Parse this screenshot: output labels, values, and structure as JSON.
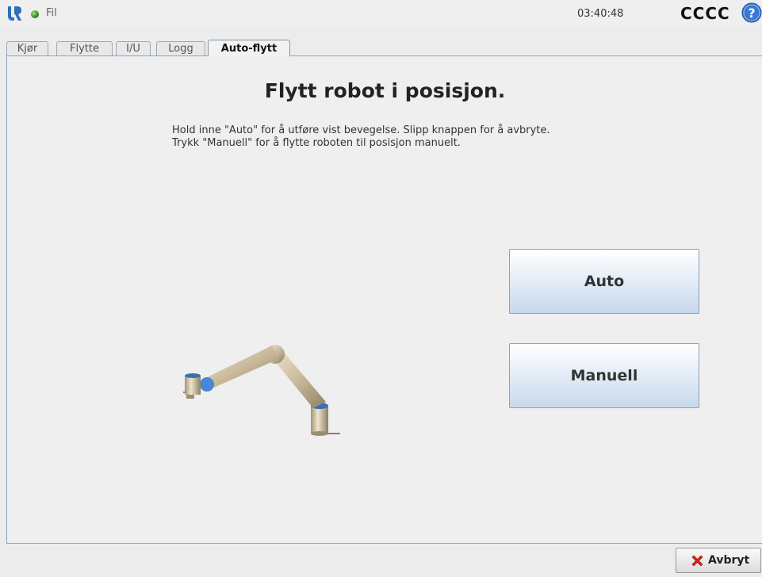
{
  "header": {
    "file_menu": "Fil",
    "time": "03:40:48",
    "robot_name": "CCCC"
  },
  "tabs": [
    {
      "label": "Kjør",
      "active": false
    },
    {
      "label": "Flytte",
      "active": false
    },
    {
      "label": "I/U",
      "active": false
    },
    {
      "label": "Logg",
      "active": false
    },
    {
      "label": "Auto-flytt",
      "active": true
    }
  ],
  "main": {
    "title": "Flytt robot i posisjon.",
    "instructions": [
      "Hold inne \"Auto\" for å utføre vist bevegelse. Slipp knappen for å avbryte.",
      "Trykk \"Manuell\" for å flytte roboten til posisjon manuelt."
    ],
    "auto_label": "Auto",
    "manual_label": "Manuell"
  },
  "footer": {
    "cancel_label": "Avbryt"
  },
  "icons": {
    "logo": "ur-logo-icon",
    "status": "status-led-icon",
    "help": "help-icon",
    "cancel": "red-x-icon"
  },
  "colors": {
    "status_led": "#2e8b1f",
    "help_icon": "#3a78d4",
    "cancel_x": "#d02a1a",
    "button_gradient_bottom": "#c7d9ec"
  }
}
